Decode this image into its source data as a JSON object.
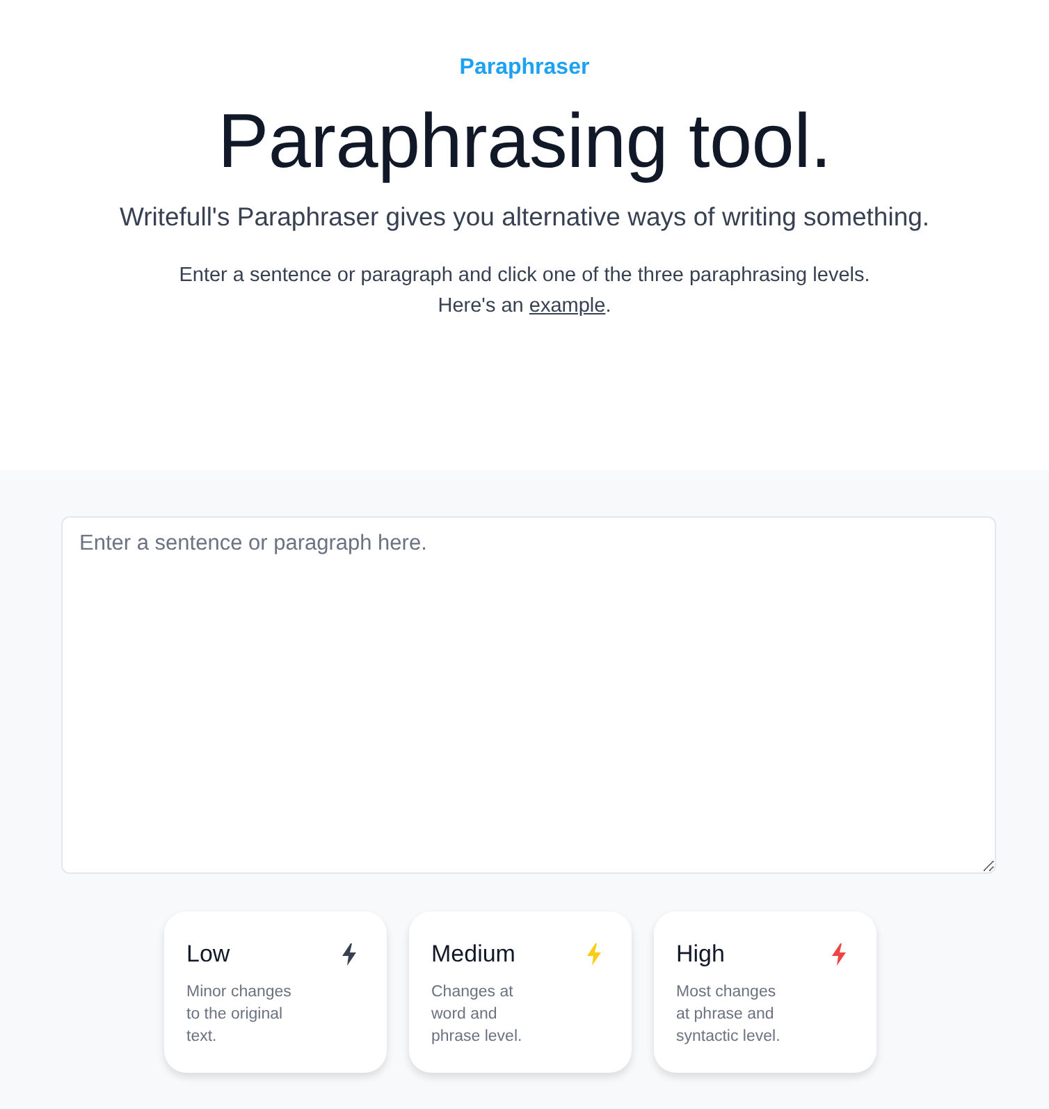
{
  "header": {
    "eyebrow": "Paraphraser",
    "title": "Paraphrasing tool.",
    "subtitle": "Writefull's Paraphraser gives you alternative ways of writing something.",
    "instructions": "Enter a sentence or paragraph and click one of the three paraphrasing levels.",
    "example_before": "Here's an",
    "example_link": "example",
    "example_after": "."
  },
  "input": {
    "placeholder": "Enter a sentence or paragraph here."
  },
  "levels": [
    {
      "label": "Low",
      "description": "Minor changes to the original text.",
      "color": "#374151"
    },
    {
      "label": "Medium",
      "description": "Changes at word and phrase level.",
      "color": "#facc15"
    },
    {
      "label": "High",
      "description": "Most changes at phrase and syntactic level.",
      "color": "#ef4444"
    }
  ]
}
